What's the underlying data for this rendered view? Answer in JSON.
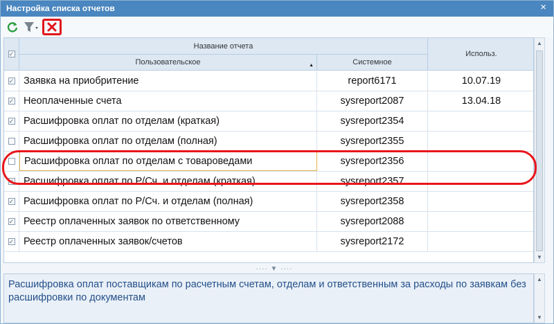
{
  "window": {
    "title": "Настройка списка отчетов",
    "close_glyph": "×"
  },
  "toolbar": {
    "refresh_icon": "refresh-icon",
    "filter_icon": "filter-icon",
    "remove_icon": "remove-icon"
  },
  "grid": {
    "header": {
      "check_glyph": "✓",
      "group_label": "Название отчета",
      "col_user": "Пользовательское",
      "col_sys": "Системное",
      "col_used": "Использ."
    },
    "rows": [
      {
        "checked": true,
        "name": "Заявка на приобритение",
        "system": "report6171",
        "used": "10.07.19"
      },
      {
        "checked": true,
        "name": "Неоплаченные счета",
        "system": "sysreport2087",
        "used": "13.04.18"
      },
      {
        "checked": true,
        "name": "Расшифровка оплат по отделам (краткая)",
        "system": "sysreport2354",
        "used": ""
      },
      {
        "checked": false,
        "name": "Расшифровка оплат по отделам (полная)",
        "system": "sysreport2355",
        "used": ""
      },
      {
        "checked": false,
        "name": "Расшифровка оплат по отделам с товароведами",
        "system": "sysreport2356",
        "used": "",
        "selected": true
      },
      {
        "checked": true,
        "name": "Расшифровка оплат по Р/Сч. и отделам (краткая)",
        "system": "sysreport2357",
        "used": ""
      },
      {
        "checked": true,
        "name": "Расшифровка оплат по Р/Сч. и отделам (полная)",
        "system": "sysreport2358",
        "used": ""
      },
      {
        "checked": true,
        "name": "Реестр оплаченных заявок по ответственному",
        "system": "sysreport2088",
        "used": ""
      },
      {
        "checked": true,
        "name": "Реестр оплаченных заявок/счетов",
        "system": "sysreport2172",
        "used": ""
      }
    ]
  },
  "splitter": {
    "grip": "···· ▼ ····"
  },
  "description": "Расшифровка оплат поставщикам по расчетным счетам, отделам и ответственным за расходы по заявкам без расшифровки по документам",
  "colors": {
    "titlebar": "#4a86bf",
    "annotation": "#e8161c",
    "description_text": "#244f8a",
    "selected_border": "#e0b24a"
  }
}
